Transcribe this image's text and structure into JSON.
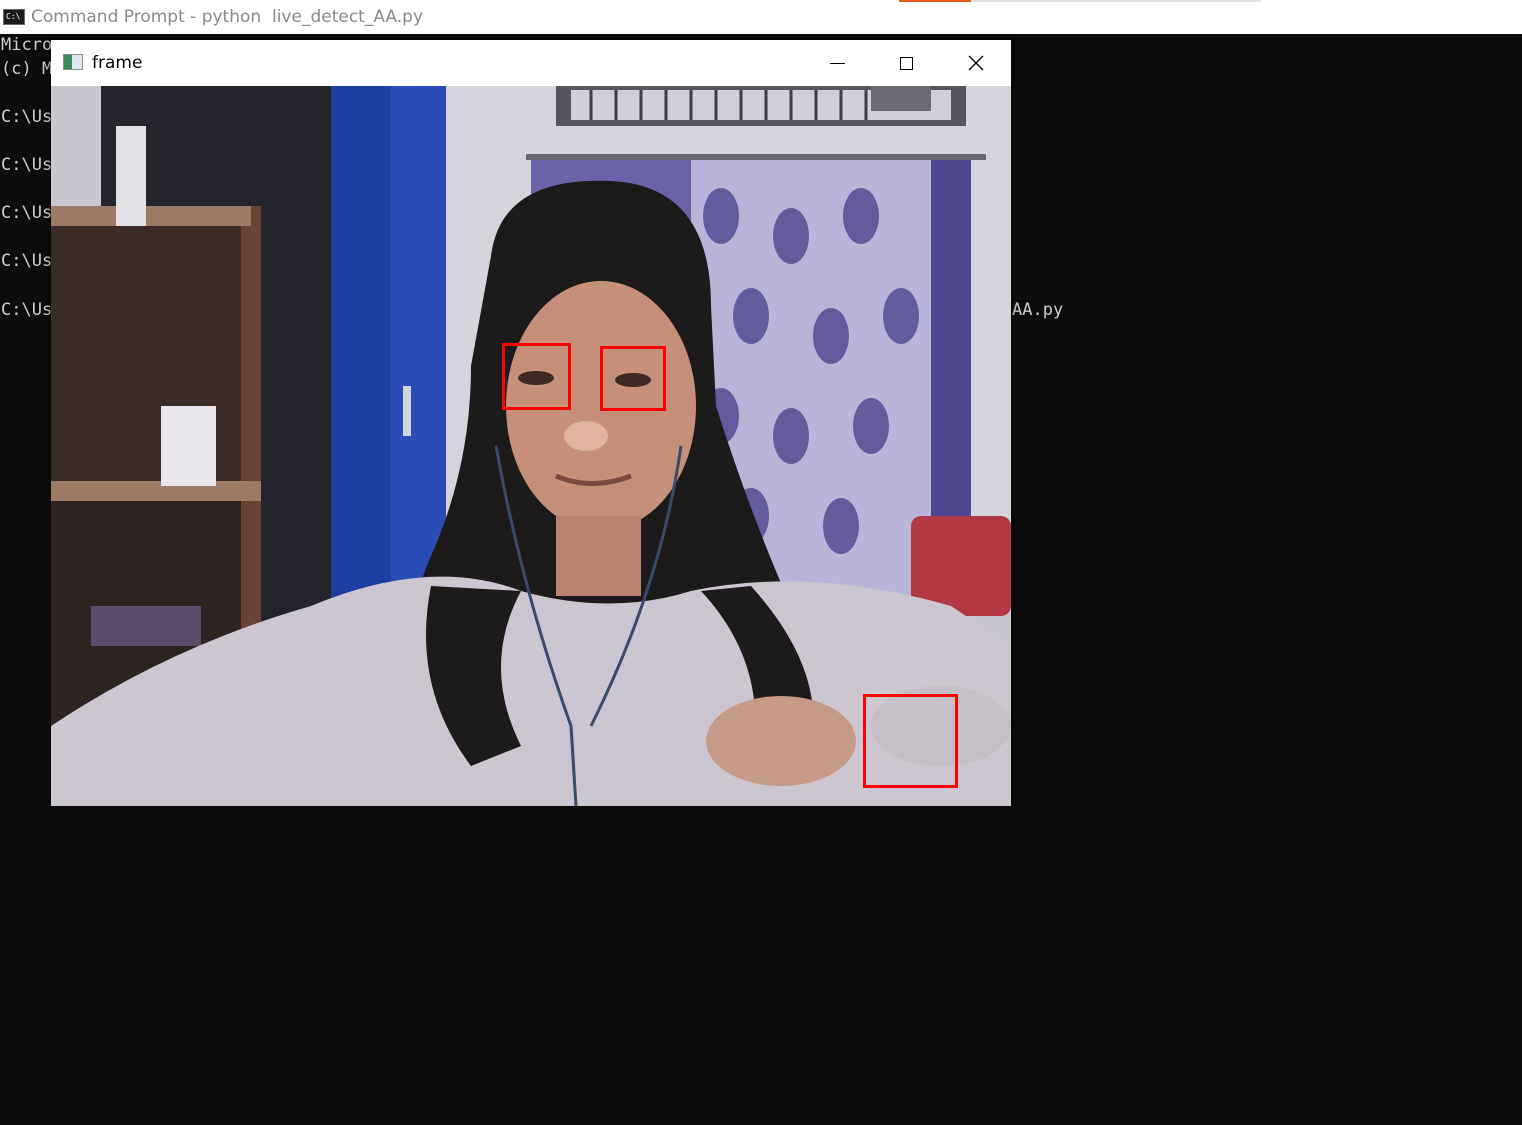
{
  "cmd_window": {
    "title": "Command Prompt - python  live_detect_AA.py",
    "console_lines": [
      "Micro",
      "(c) M",
      "",
      "C:\\Us",
      "",
      "C:\\Us",
      "",
      "C:\\Us",
      "",
      "C:\\Us",
      "",
      "C:\\Us"
    ],
    "console_tail": "AA.py",
    "colors": {
      "background": "#0c0c0c",
      "text": "#cccccc",
      "taskbar_accent": "#e8571b"
    }
  },
  "frame_window": {
    "title": "frame",
    "buttons": {
      "minimize_icon": "minimize-icon",
      "maximize_icon": "maximize-icon",
      "close_icon": "close-icon"
    },
    "detection_box_color": "#ff0000",
    "detections": [
      {
        "label": "left eye"
      },
      {
        "label": "right eye"
      },
      {
        "label": "false positive"
      }
    ]
  }
}
